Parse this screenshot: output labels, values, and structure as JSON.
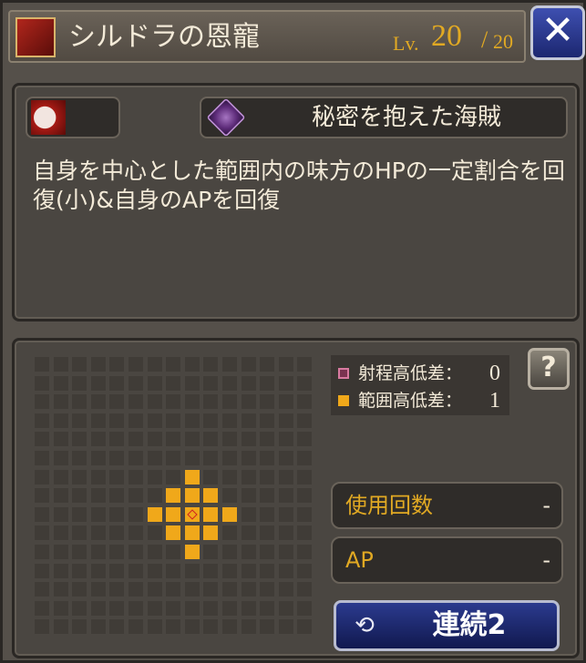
{
  "header": {
    "title": "シルドラの恩寵",
    "level_label": "Lv.",
    "level_value": "20",
    "level_slash": "/",
    "level_max": "20",
    "close_icon": "close-icon"
  },
  "info": {
    "element_icon": "slash-element-icon",
    "trait_icon": "emblem-icon",
    "trait_label": "秘密を抱えた海賊",
    "description": "自身を中心とした範囲内の味方のHPの一定割合を回復(小)&自身のAPを回復"
  },
  "range": {
    "grid_size": 15,
    "center": [
      8,
      8
    ],
    "effect_cells": [
      [
        8,
        6
      ],
      [
        7,
        7
      ],
      [
        8,
        7
      ],
      [
        9,
        7
      ],
      [
        6,
        8
      ],
      [
        7,
        8
      ],
      [
        8,
        8
      ],
      [
        9,
        8
      ],
      [
        10,
        8
      ],
      [
        7,
        9
      ],
      [
        8,
        9
      ],
      [
        9,
        9
      ],
      [
        8,
        10
      ]
    ],
    "legend": {
      "range_height_label": "射程高低差：",
      "range_height_value": "0",
      "area_height_label": "範囲高低差：",
      "area_height_value": "1"
    },
    "help_label": "?",
    "uses_label": "使用回数",
    "uses_value": "-",
    "ap_label": "AP",
    "ap_value": "-",
    "chain_label": "連続2",
    "chain_icon": "refresh-icon"
  },
  "colors": {
    "area": "#f0a81a",
    "gold_text": "#e1a923",
    "panel": "#4a4641"
  }
}
